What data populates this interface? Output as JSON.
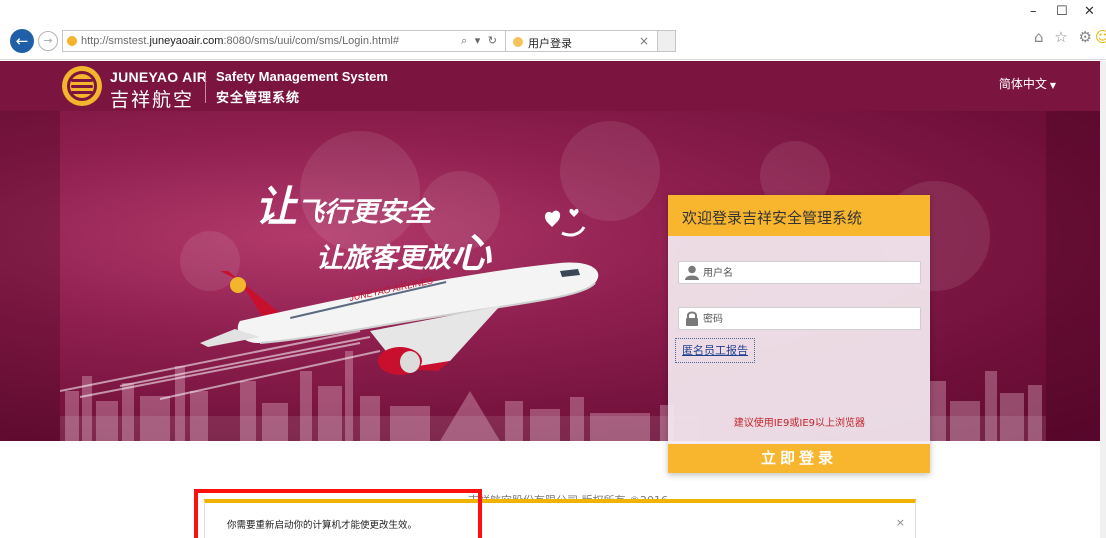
{
  "browser": {
    "url_prefix": "http://smstest.",
    "url_domain": "juneyaoair.com",
    "url_suffix": ":8080/sms/uui/com/sms/Login.html#",
    "url_actions": "⌕ ▾ ↻",
    "tab_title": "用户登录",
    "tab_close": "×",
    "window_minimize": "–",
    "window_maximize": "☐",
    "window_close": "✕",
    "tool_icons": "⌂ ☆ ⚙",
    "tool_smile": "☺"
  },
  "header": {
    "brand_en": "JUNEYAO AIR",
    "brand_cn": "吉祥航空",
    "system_en": "Safety Management System",
    "system_cn": "安全管理系统",
    "language": "简体中文",
    "language_caret": "▼"
  },
  "banner": {
    "slogan1_big": "让",
    "slogan1_rest": "飞行更安全",
    "slogan2_start": "让旅客更放",
    "slogan2_big": "心"
  },
  "login": {
    "title": "欢迎登录吉祥安全管理系统",
    "username_placeholder": "用户名",
    "password_placeholder": "密码",
    "anonymous_report": "匿名员工报告",
    "browser_tip": "建议使用IE9或IE9以上浏览器",
    "login_button": "立即登录"
  },
  "footer": {
    "copyright": "吉祥航空股份有限公司 版权所有 ©2016"
  },
  "notification": {
    "message": "你需要重新启动你的计算机才能使更改生效。",
    "close": "×"
  },
  "colors": {
    "brand_purple": "#7b1540",
    "accent_gold": "#f8b62e",
    "warning_red": "#c2232c"
  }
}
